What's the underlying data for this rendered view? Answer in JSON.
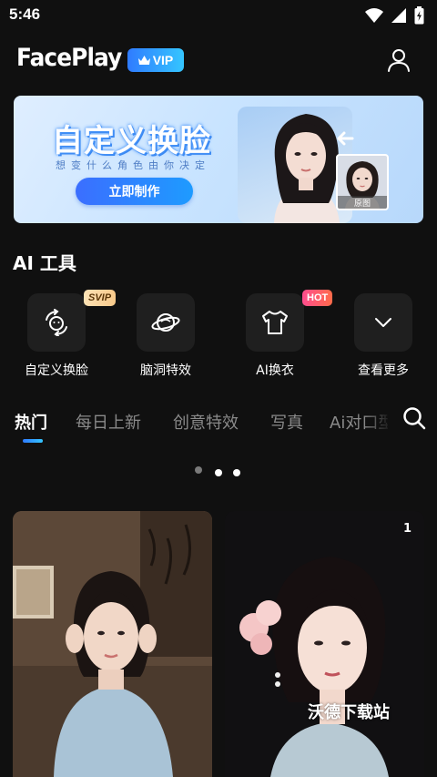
{
  "status_bar": {
    "time": "5:46",
    "icons": [
      "wifi-icon",
      "signal-icon",
      "battery-icon"
    ]
  },
  "header": {
    "logo": "FacePlay",
    "vip_label": "VIP",
    "vip_icon": "crown-icon",
    "profile_icon": "user-icon"
  },
  "banner": {
    "title": "自定义换脸",
    "subtitle": "想变什么角色由你决定",
    "button_label": "立即制作",
    "original_label": "原图"
  },
  "ai_tools": {
    "title": "AI 工具",
    "items": [
      {
        "label": "自定义换脸",
        "icon": "face-swap-icon",
        "tag": "SVIP"
      },
      {
        "label": "脑洞特效",
        "icon": "planet-icon",
        "tag": ""
      },
      {
        "label": "AI换衣",
        "icon": "shirt-icon",
        "tag": "HOT"
      },
      {
        "label": "查看更多",
        "icon": "chevron-down-icon",
        "tag": ""
      }
    ]
  },
  "tabs": {
    "items": [
      "热门",
      "每日上新",
      "创意特效",
      "写真",
      "Ai对口型"
    ],
    "active_index": 0,
    "search_icon": "search-icon"
  },
  "pager": {
    "count": 3,
    "active_index": 0
  },
  "feed": {
    "cards": [
      {
        "count": ""
      },
      {
        "count": "1"
      }
    ],
    "watermark": "沃德下载站"
  },
  "colors": {
    "accent": "#2f7bff",
    "accent_light": "#35c6ff",
    "background": "#101010",
    "tile": "#1f1f1f",
    "hot": "#ff4d8e"
  }
}
